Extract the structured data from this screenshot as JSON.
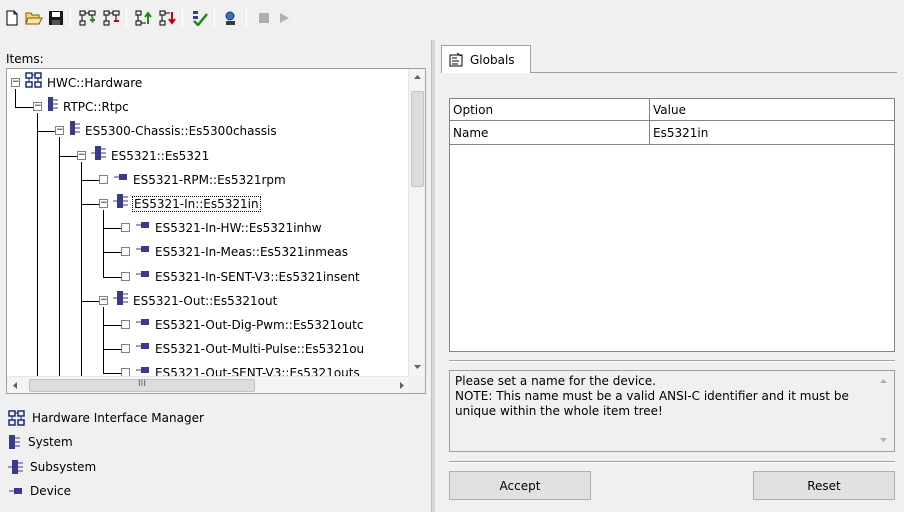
{
  "toolbar": {
    "buttons": [
      {
        "name": "new-icon"
      },
      {
        "name": "open-icon"
      },
      {
        "name": "save-icon"
      },
      {
        "name": "add-node-icon"
      },
      {
        "name": "remove-node-icon"
      },
      {
        "name": "move-up-icon"
      },
      {
        "name": "move-down-icon"
      },
      {
        "name": "validate-icon"
      },
      {
        "name": "find-icon"
      },
      {
        "name": "stop-icon"
      },
      {
        "name": "play-icon"
      }
    ]
  },
  "tree": {
    "label": "Items:",
    "rows": [
      {
        "label": "HWC::Hardware",
        "type": "hwm",
        "level": 0,
        "expanded": true
      },
      {
        "label": "RTPC::Rtpc",
        "type": "system",
        "level": 1,
        "expanded": true
      },
      {
        "label": "ES5300-Chassis::Es5300chassis",
        "type": "system",
        "level": 2,
        "expanded": true
      },
      {
        "label": "ES5321::Es5321",
        "type": "subsystem",
        "level": 3,
        "expanded": true
      },
      {
        "label": "ES5321-RPM::Es5321rpm",
        "type": "device",
        "level": 4,
        "checkbox": true
      },
      {
        "label": "ES5321-In::Es5321in",
        "type": "subsystem",
        "level": 4,
        "expanded": true,
        "selected": true
      },
      {
        "label": "ES5321-In-HW::Es5321inhw",
        "type": "device",
        "level": 5,
        "checkbox": true
      },
      {
        "label": "ES5321-In-Meas::Es5321inmeas",
        "type": "device",
        "level": 5,
        "checkbox": true
      },
      {
        "label": "ES5321-In-SENT-V3::Es5321insent",
        "type": "device",
        "level": 5,
        "checkbox": true
      },
      {
        "label": "ES5321-Out::Es5321out",
        "type": "subsystem",
        "level": 4,
        "expanded": true
      },
      {
        "label": "ES5321-Out-Dig-Pwm::Es5321outc",
        "type": "device",
        "level": 5,
        "checkbox": true
      },
      {
        "label": "ES5321-Out-Multi-Pulse::Es5321ou",
        "type": "device",
        "level": 5,
        "checkbox": true
      },
      {
        "label": "ES5321-Out-SENT-V3::Es5321outs",
        "type": "device",
        "level": 5,
        "checkbox": true
      }
    ],
    "hscroll_grip": "III"
  },
  "legend": [
    {
      "label": "Hardware Interface Manager",
      "icon": "hwm-icon"
    },
    {
      "label": "System",
      "icon": "system-icon"
    },
    {
      "label": "Subsystem",
      "icon": "subsystem-icon"
    },
    {
      "label": "Device",
      "icon": "device-icon"
    }
  ],
  "tab": {
    "label": "Globals"
  },
  "grid": {
    "headers": [
      "Option",
      "Value"
    ],
    "rows": [
      [
        "Name",
        "Es5321in"
      ]
    ]
  },
  "hint": {
    "text": "Please set a name for the device.\nNOTE: This name must be a valid ANSI-C identifier and it must be unique within the whole item tree!"
  },
  "buttons": {
    "accept": "Accept",
    "reset": "Reset"
  }
}
